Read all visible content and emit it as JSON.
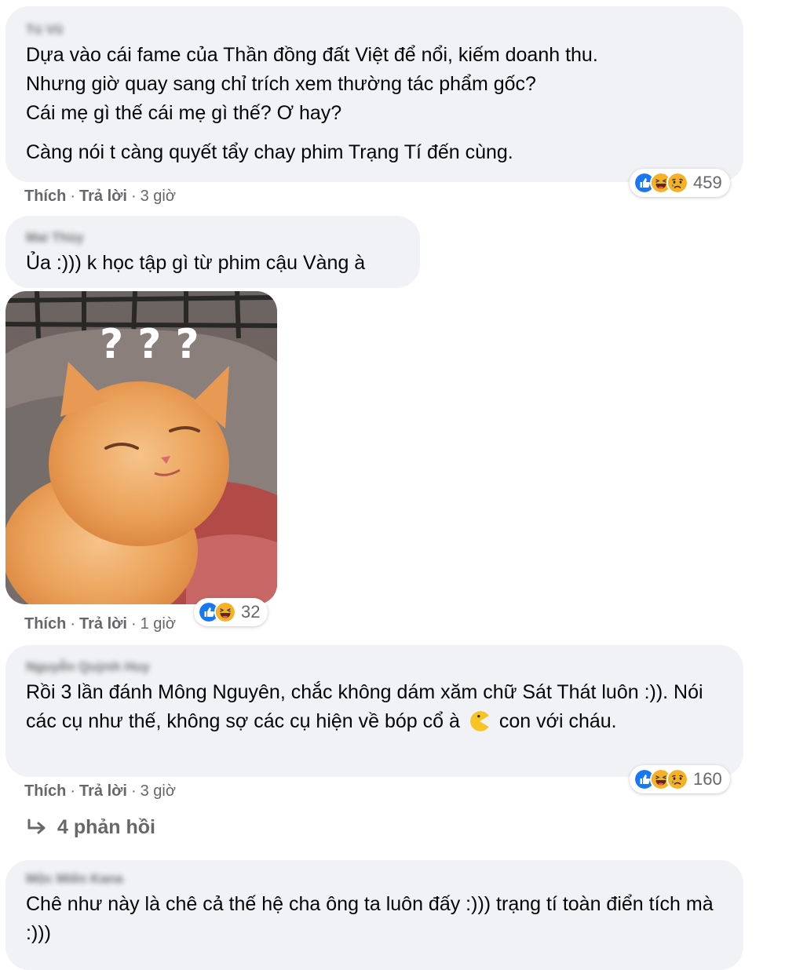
{
  "comments": [
    {
      "paragraphs": [
        "Dựa vào cái fame của Thần đồng đất Việt để nổi, kiếm doanh thu.\nNhưng giờ quay sang chỉ trích xem thường tác phẩm gốc?\nCái mẹ gì thế cái mẹ gì thế? Ơ hay?",
        "Càng nói t càng quyết tẩy chay phim Trạng Tí đến cùng."
      ],
      "actions": {
        "like": "Thích",
        "reply": "Trả lời",
        "time": "3 giờ"
      },
      "reactions": {
        "icons": [
          "like-icon",
          "haha-icon",
          "sad-icon"
        ],
        "count": "459"
      }
    },
    {
      "text": "Ủa :))) k học tập gì từ phim cậu Vàng à",
      "image": {
        "overlay": "? ? ?"
      },
      "actions": {
        "like": "Thích",
        "reply": "Trả lời",
        "time": "1 giờ"
      },
      "reactions": {
        "icons": [
          "like-icon",
          "haha-icon"
        ],
        "count": "32"
      }
    },
    {
      "text_before": "Rồi 3 lần đánh Mông Nguyên, chắc không dám xăm chữ Sát Thát luôn :)). Nói các cụ như thế, không sợ các cụ hiện về bóp cổ à",
      "text_after": "con với cháu.",
      "actions": {
        "like": "Thích",
        "reply": "Trả lời",
        "time": "3 giờ"
      },
      "reactions": {
        "icons": [
          "like-icon",
          "haha-icon",
          "sad-icon"
        ],
        "count": "160"
      },
      "replies": "4 phản hồi"
    },
    {
      "text": "Chê như này là chê cả thế hệ cha ông ta luôn đấy :))) trạng tí toàn điển tích mà :)))"
    }
  ],
  "colors": {
    "bubble": "#f0f2f5",
    "like": "#1877f2",
    "haha": "#f7b125",
    "meta": "#65676b"
  }
}
